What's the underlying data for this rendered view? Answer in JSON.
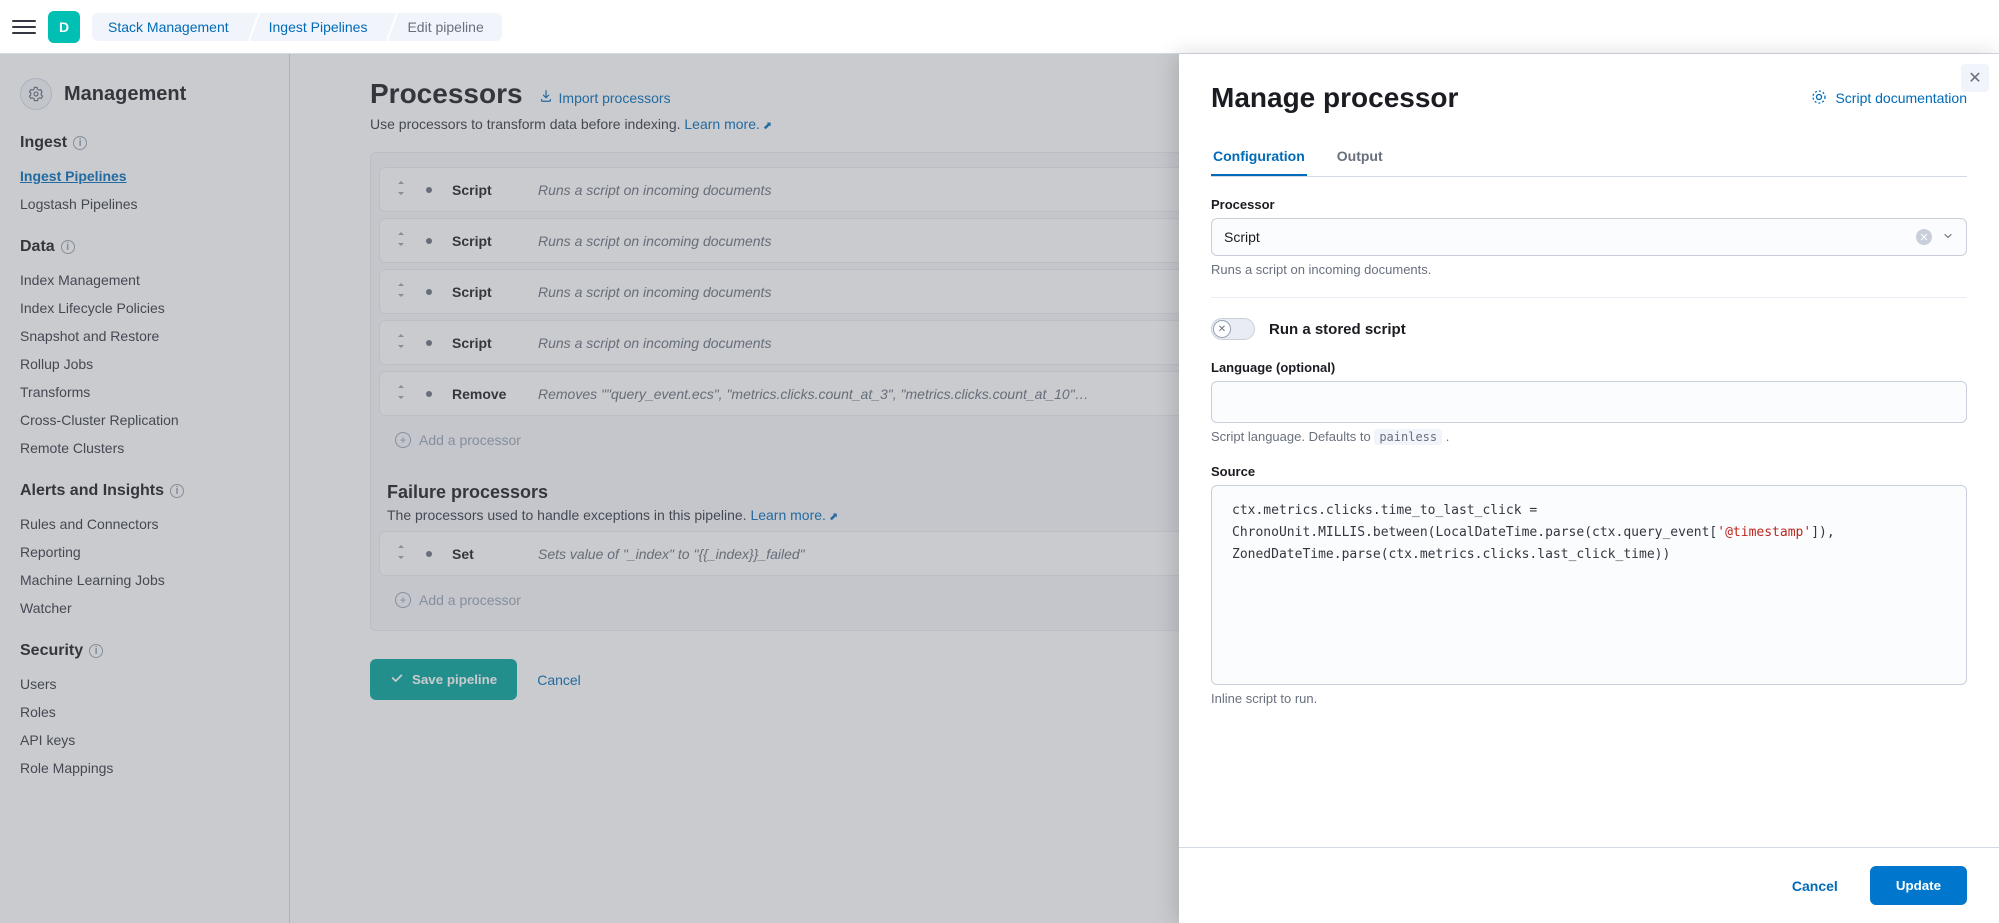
{
  "topbar": {
    "space_letter": "D",
    "breadcrumbs": [
      "Stack Management",
      "Ingest Pipelines",
      "Edit pipeline"
    ]
  },
  "sidebar": {
    "title": "Management",
    "sections": [
      {
        "title": "Ingest",
        "items": [
          {
            "label": "Ingest Pipelines",
            "active": true
          },
          {
            "label": "Logstash Pipelines"
          }
        ]
      },
      {
        "title": "Data",
        "items": [
          {
            "label": "Index Management"
          },
          {
            "label": "Index Lifecycle Policies"
          },
          {
            "label": "Snapshot and Restore"
          },
          {
            "label": "Rollup Jobs"
          },
          {
            "label": "Transforms"
          },
          {
            "label": "Cross-Cluster Replication"
          },
          {
            "label": "Remote Clusters"
          }
        ]
      },
      {
        "title": "Alerts and Insights",
        "items": [
          {
            "label": "Rules and Connectors"
          },
          {
            "label": "Reporting"
          },
          {
            "label": "Machine Learning Jobs"
          },
          {
            "label": "Watcher"
          }
        ]
      },
      {
        "title": "Security",
        "items": [
          {
            "label": "Users"
          },
          {
            "label": "Roles"
          },
          {
            "label": "API keys"
          },
          {
            "label": "Role Mappings"
          }
        ]
      }
    ]
  },
  "content": {
    "processors_title": "Processors",
    "import_label": "Import processors",
    "subtext": "Use processors to transform data before indexing.",
    "learn_more": "Learn more.",
    "processors": [
      {
        "name": "Script",
        "desc": "Runs a script on incoming documents"
      },
      {
        "name": "Script",
        "desc": "Runs a script on incoming documents"
      },
      {
        "name": "Script",
        "desc": "Runs a script on incoming documents"
      },
      {
        "name": "Script",
        "desc": "Runs a script on incoming documents"
      },
      {
        "name": "Remove",
        "desc": "Removes \"\"query_event.ecs\", \"metrics.clicks.count_at_3\", \"metrics.clicks.count_at_10\"…"
      }
    ],
    "add_processor": "Add a processor",
    "failure_title": "Failure processors",
    "failure_sub": "The processors used to handle exceptions in this pipeline.",
    "failure_processors": [
      {
        "name": "Set",
        "desc": "Sets value of \"_index\" to \"{{_index}}_failed\""
      }
    ],
    "save_label": "Save pipeline",
    "cancel_label": "Cancel"
  },
  "flyout": {
    "title": "Manage processor",
    "doc_link": "Script documentation",
    "tabs": {
      "configuration": "Configuration",
      "output": "Output"
    },
    "processor_label": "Processor",
    "processor_value": "Script",
    "processor_help": "Runs a script on incoming documents.",
    "stored_script_label": "Run a stored script",
    "language_label": "Language (optional)",
    "language_value": "",
    "language_help_prefix": "Script language. Defaults to ",
    "language_help_code": "painless",
    "language_help_suffix": " .",
    "source_label": "Source",
    "source_code_prefix": "ctx.metrics.clicks.time_to_last_click = ChronoUnit.MILLIS.between(LocalDateTime.parse(ctx.query_event[",
    "source_code_string": "'@timestamp'",
    "source_code_suffix": "]), ZonedDateTime.parse(ctx.metrics.clicks.last_click_time))",
    "source_help": "Inline script to run.",
    "cancel": "Cancel",
    "update": "Update"
  }
}
